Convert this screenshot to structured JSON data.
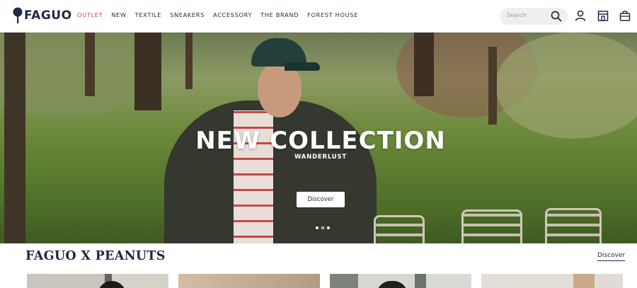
{
  "brand": {
    "name": "FAGUO",
    "accent_color": "#c8453b",
    "text_color": "#1e2a44"
  },
  "nav": {
    "items": [
      {
        "label": "OUTLET",
        "active": true
      },
      {
        "label": "NEW",
        "active": false
      },
      {
        "label": "TEXTILE",
        "active": false
      },
      {
        "label": "SNEAKERS",
        "active": false
      },
      {
        "label": "ACCESSORY",
        "active": false
      },
      {
        "label": "THE BRAND",
        "active": false
      },
      {
        "label": "FOREST HOUSE",
        "active": false
      }
    ]
  },
  "search": {
    "placeholder": "Search",
    "icon": "search-icon"
  },
  "header_icons": [
    "account-icon",
    "store-icon",
    "bag-icon"
  ],
  "hero": {
    "title": "NEW COLLECTION",
    "subtitle": "WANDERLUST",
    "button_label": "Discover",
    "slides": {
      "count": 3,
      "current": 2
    }
  },
  "section": {
    "title": "FAGUO X PEANUTS",
    "link_label": "Discover"
  }
}
